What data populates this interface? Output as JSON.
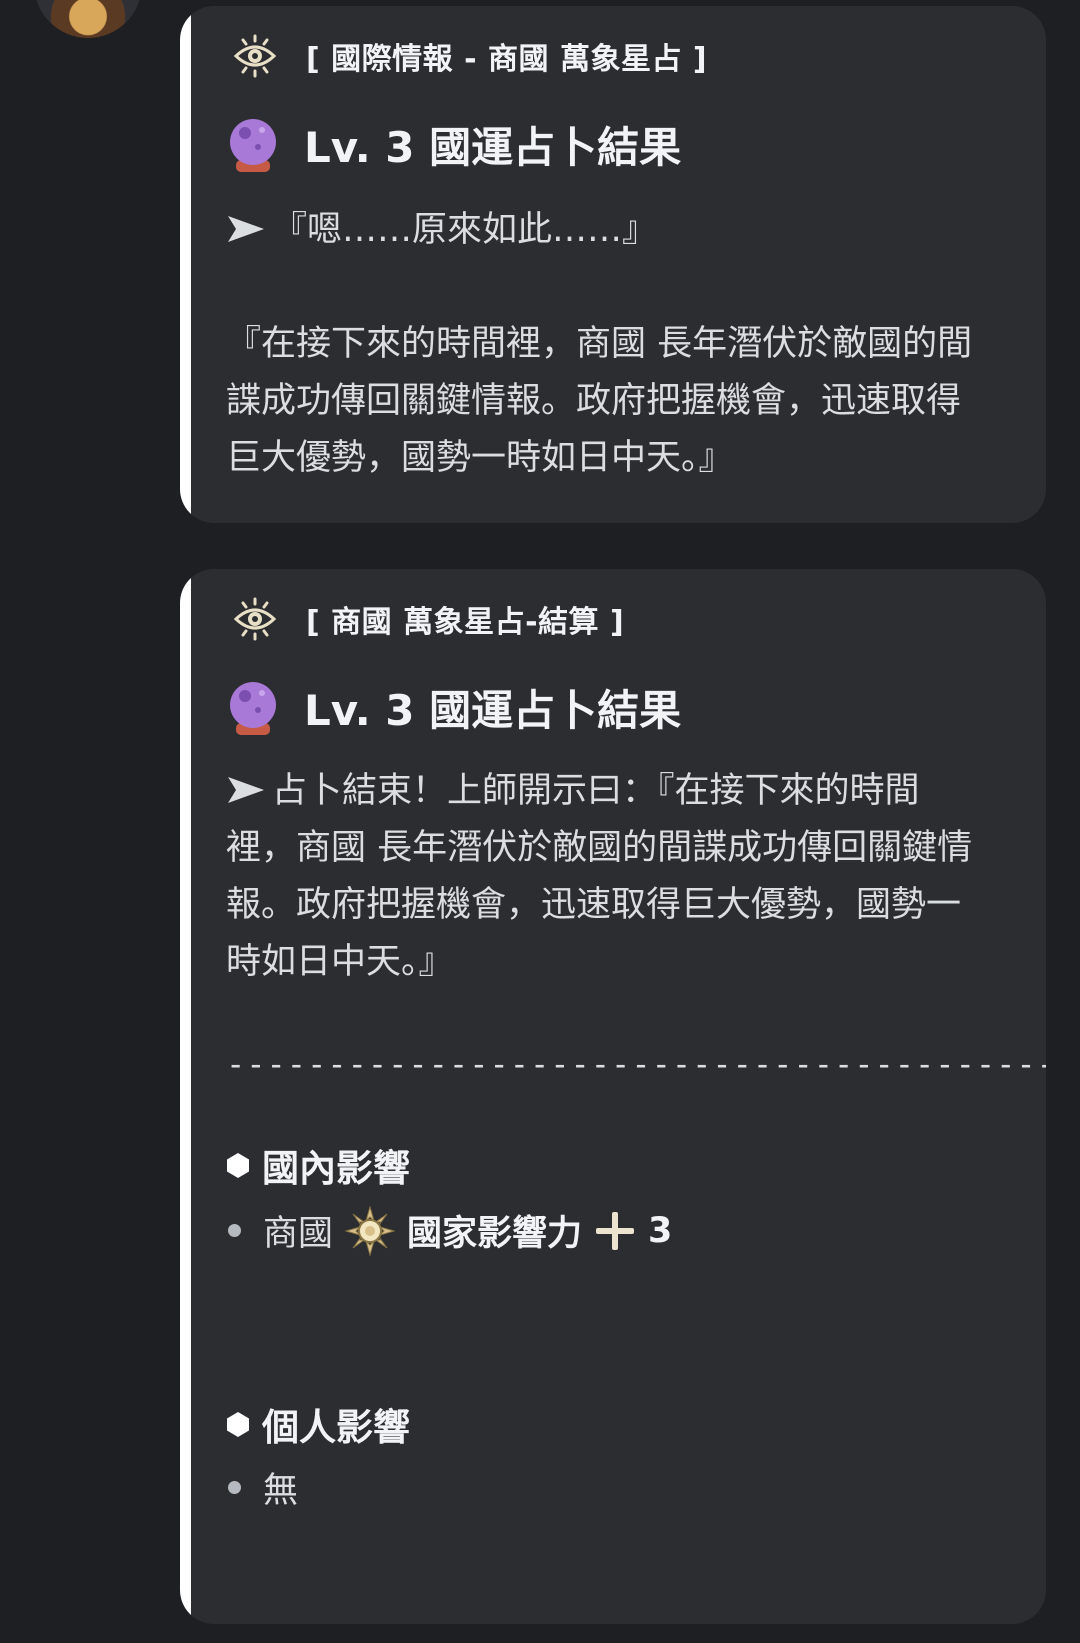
{
  "colors": {
    "background": "#1e1f22",
    "embed_background": "#2b2d31",
    "embed_accent_bar": "#ffffff",
    "text": "#dbdee1",
    "heading": "#f2f3f5",
    "crystal_ball": "#a879d6"
  },
  "messages": [
    {
      "author_icon": "eye-icon",
      "author": "[ 國際情報 - 商國 萬象星占 ]",
      "title_icon": "crystal-ball-icon",
      "title": "Lv. 3 國運占卜結果",
      "arrow_icon": "arrow-right-icon",
      "quote_line": "『嗯……原來如此……』",
      "body": "『在接下來的時間裡，商國 長年潛伏於敵國的間諜成功傳回關鍵情報。政府把握機會，迅速取得巨大優勢，國勢一時如日中天。』"
    },
    {
      "author_icon": "eye-icon",
      "author": "[ 商國 萬象星占-結算 ]",
      "title_icon": "crystal-ball-icon",
      "title": "Lv. 3 國運占卜結果",
      "arrow_icon": "arrow-right-icon",
      "body": "占卜結束！上師開示曰：『在接下來的時間裡，商國 長年潛伏於敵國的間諜成功傳回關鍵情報。政府把握機會，迅速取得巨大優勢，國勢一時如日中天。』",
      "separator": "------------------------------------------",
      "sections": [
        {
          "icon": "hexagon-icon",
          "heading": "國內影響",
          "items": [
            {
              "country": "商國",
              "badge_icon": "sun-emblem-icon",
              "stat": "國家影響力",
              "plus_icon": "plus-icon",
              "value": "3"
            }
          ]
        },
        {
          "icon": "hexagon-icon",
          "heading": "個人影響",
          "items": [
            {
              "text": "無"
            }
          ]
        }
      ]
    }
  ]
}
